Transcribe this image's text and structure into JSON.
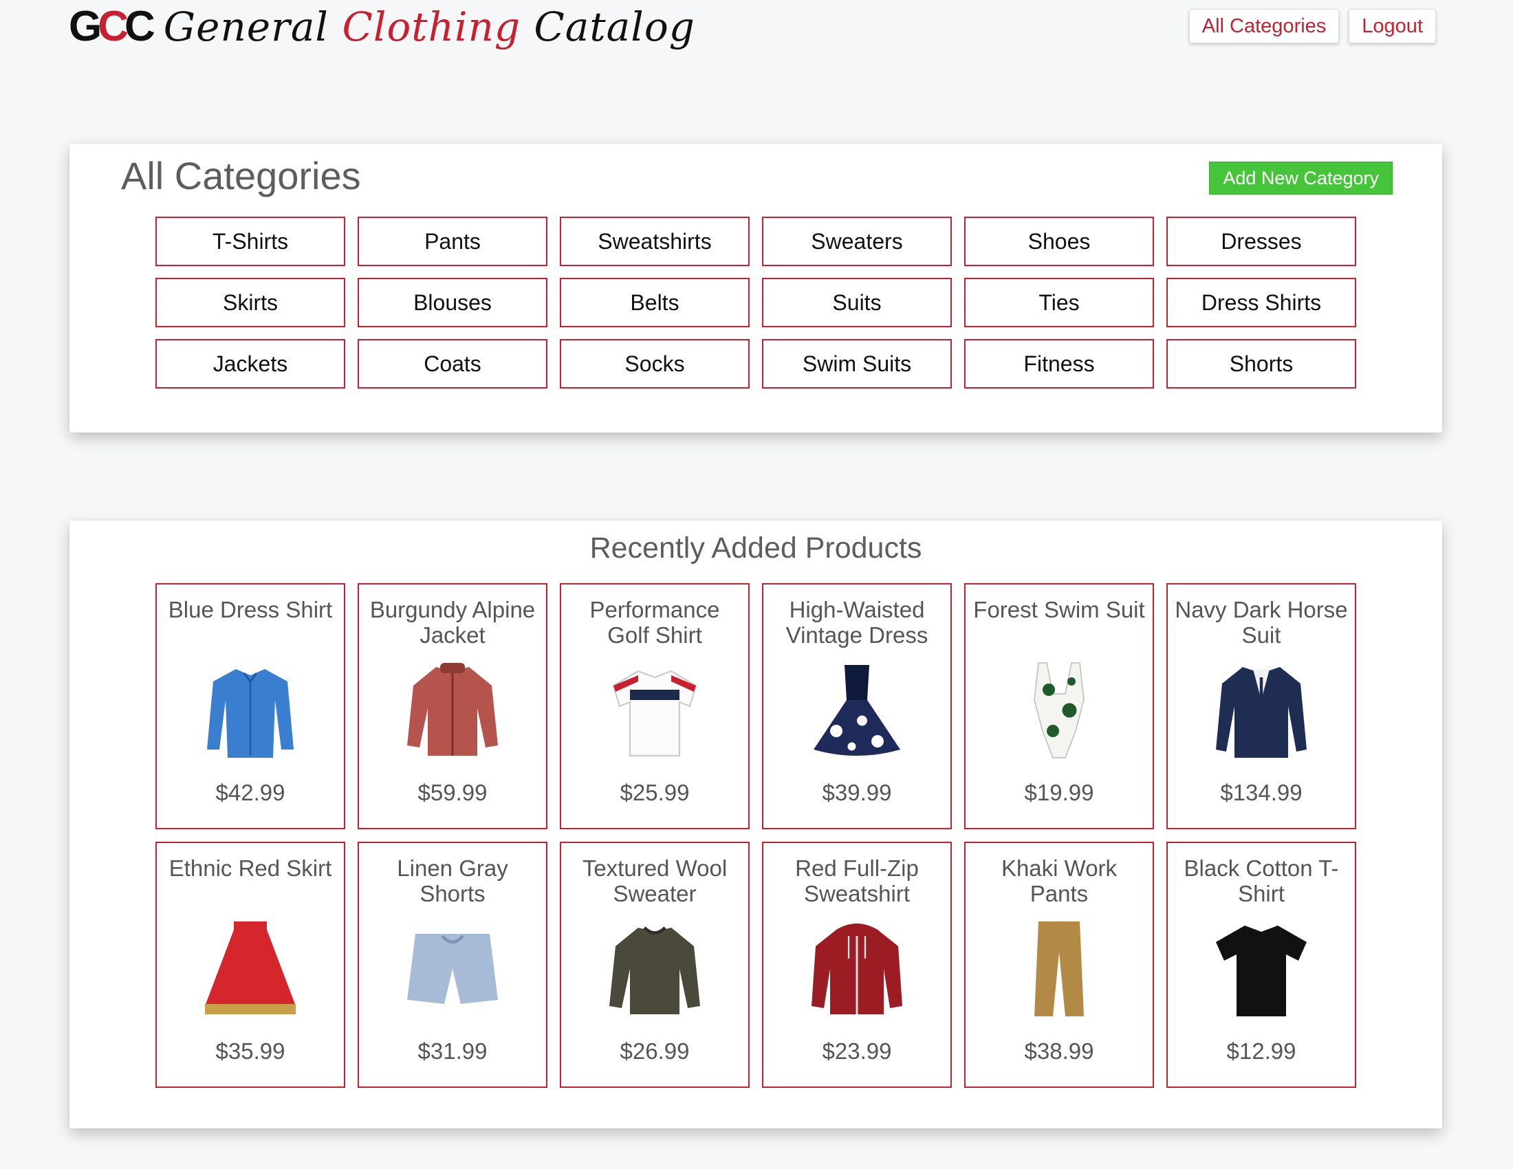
{
  "header": {
    "logo_mark": "GCC",
    "logo_word1": "General",
    "logo_word2": "Clothing",
    "logo_word3": "Catalog",
    "nav": {
      "all_categories": "All Categories",
      "logout": "Logout"
    }
  },
  "categories_panel": {
    "title": "All Categories",
    "add_button": "Add New Category",
    "items": [
      "T-Shirts",
      "Pants",
      "Sweatshirts",
      "Sweaters",
      "Shoes",
      "Dresses",
      "Skirts",
      "Blouses",
      "Belts",
      "Suits",
      "Ties",
      "Dress Shirts",
      "Jackets",
      "Coats",
      "Socks",
      "Swim Suits",
      "Fitness",
      "Shorts"
    ]
  },
  "products_panel": {
    "title": "Recently Added Products",
    "items": [
      {
        "name": "Blue Dress Shirt",
        "price": "$42.99",
        "icon": "shirt-icon"
      },
      {
        "name": "Burgundy Alpine Jacket",
        "price": "$59.99",
        "icon": "jacket-icon"
      },
      {
        "name": "Performance Golf Shirt",
        "price": "$25.99",
        "icon": "polo-icon"
      },
      {
        "name": "High-Waisted Vintage Dress",
        "price": "$39.99",
        "icon": "dress-icon"
      },
      {
        "name": "Forest Swim Suit",
        "price": "$19.99",
        "icon": "swimsuit-icon"
      },
      {
        "name": "Navy Dark Horse Suit",
        "price": "$134.99",
        "icon": "suit-icon"
      },
      {
        "name": "Ethnic Red Skirt",
        "price": "$35.99",
        "icon": "skirt-icon"
      },
      {
        "name": "Linen Gray Shorts",
        "price": "$31.99",
        "icon": "shorts-icon"
      },
      {
        "name": "Textured Wool Sweater",
        "price": "$26.99",
        "icon": "sweater-icon"
      },
      {
        "name": "Red Full-Zip Sweatshirt",
        "price": "$23.99",
        "icon": "hoodie-icon"
      },
      {
        "name": "Khaki Work Pants",
        "price": "$38.99",
        "icon": "pants-icon"
      },
      {
        "name": "Black Cotton T-Shirt",
        "price": "$12.99",
        "icon": "tshirt-icon"
      }
    ]
  },
  "colors": {
    "accent_red": "#c8202f",
    "button_green": "#46c43a"
  }
}
